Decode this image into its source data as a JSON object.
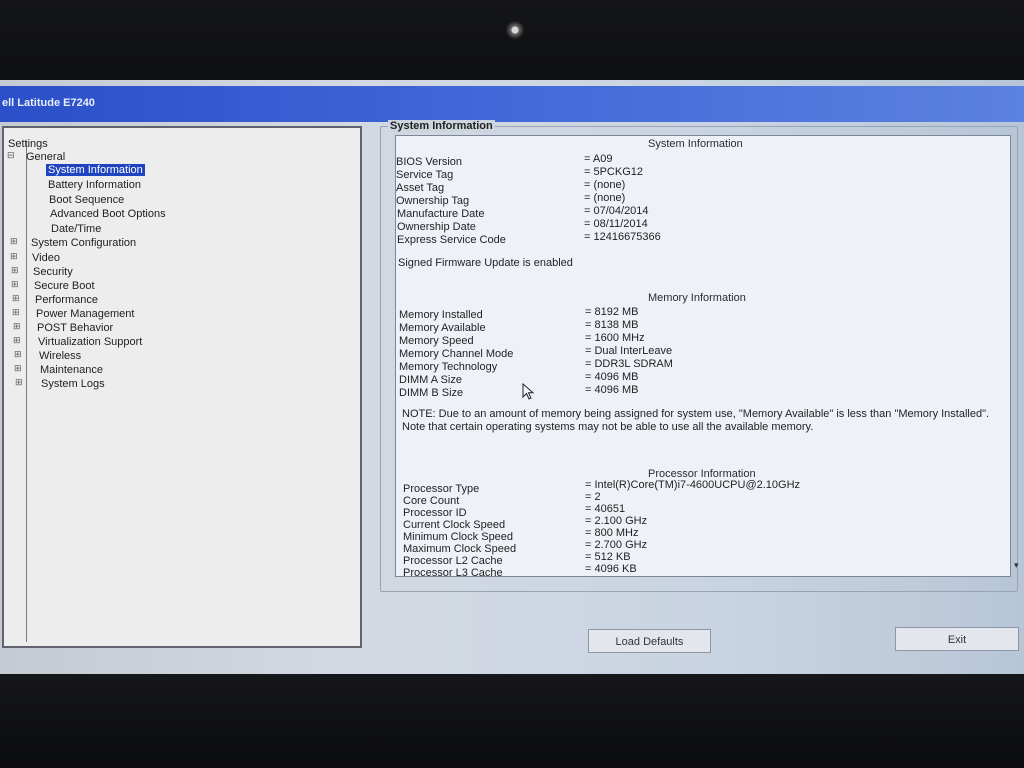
{
  "window": {
    "title": "ell Latitude E7240"
  },
  "tree": {
    "root": "Settings",
    "general": "General",
    "general_children": [
      "System Information",
      "Battery Information",
      "Boot Sequence",
      "Advanced Boot Options",
      "Date/Time"
    ],
    "categories": [
      "System Configuration",
      "Video",
      "Security",
      "Secure Boot",
      "Performance",
      "Power Management",
      "POST Behavior",
      "Virtualization Support",
      "Wireless",
      "Maintenance",
      "System Logs"
    ],
    "selected": "System Information"
  },
  "panel": {
    "frame_title": "System Information",
    "system_header": "System Information",
    "system_rows": [
      {
        "label": "BIOS Version",
        "value": "= A09"
      },
      {
        "label": "Service Tag",
        "value": "= 5PCKG12"
      },
      {
        "label": "Asset Tag",
        "value": "= (none)"
      },
      {
        "label": "Ownership Tag",
        "value": "= (none)"
      },
      {
        "label": "Manufacture Date",
        "value": "= 07/04/2014"
      },
      {
        "label": "Ownership Date",
        "value": "= 08/11/2014"
      },
      {
        "label": "Express Service Code",
        "value": "= 12416675366"
      }
    ],
    "firmware_note": "Signed Firmware Update is enabled",
    "memory_header": "Memory Information",
    "memory_rows": [
      {
        "label": "Memory Installed",
        "value": "= 8192 MB"
      },
      {
        "label": "Memory Available",
        "value": "= 8138 MB"
      },
      {
        "label": "Memory Speed",
        "value": "= 1600 MHz"
      },
      {
        "label": "Memory Channel Mode",
        "value": "= Dual InterLeave"
      },
      {
        "label": "Memory Technology",
        "value": "= DDR3L SDRAM"
      },
      {
        "label": "DIMM A Size",
        "value": "= 4096 MB"
      },
      {
        "label": "DIMM B Size",
        "value": "= 4096 MB"
      }
    ],
    "memory_note": "NOTE: Due to an amount of memory being assigned for system use, \"Memory Available\" is less than \"Memory Installed\". Note that certain operating systems may not be able to use all the available memory.",
    "processor_header": "Processor Information",
    "processor_rows": [
      {
        "label": "Processor Type",
        "value": "= Intel(R)Core(TM)i7-4600UCPU@2.10GHz"
      },
      {
        "label": "Core Count",
        "value": "= 2"
      },
      {
        "label": "Processor ID",
        "value": "= 40651"
      },
      {
        "label": "Current Clock Speed",
        "value": "= 2.100 GHz"
      },
      {
        "label": "Minimum Clock Speed",
        "value": "= 800 MHz"
      },
      {
        "label": "Maximum Clock Speed",
        "value": "= 2.700 GHz"
      },
      {
        "label": "Processor L2 Cache",
        "value": "= 512 KB"
      },
      {
        "label": "Processor L3 Cache",
        "value": "= 4096 KB"
      }
    ]
  },
  "buttons": {
    "load_defaults": "Load Defaults",
    "exit": "Exit"
  },
  "colors": {
    "titlebar": "#2a4fc8",
    "selection": "#1f44c0"
  }
}
